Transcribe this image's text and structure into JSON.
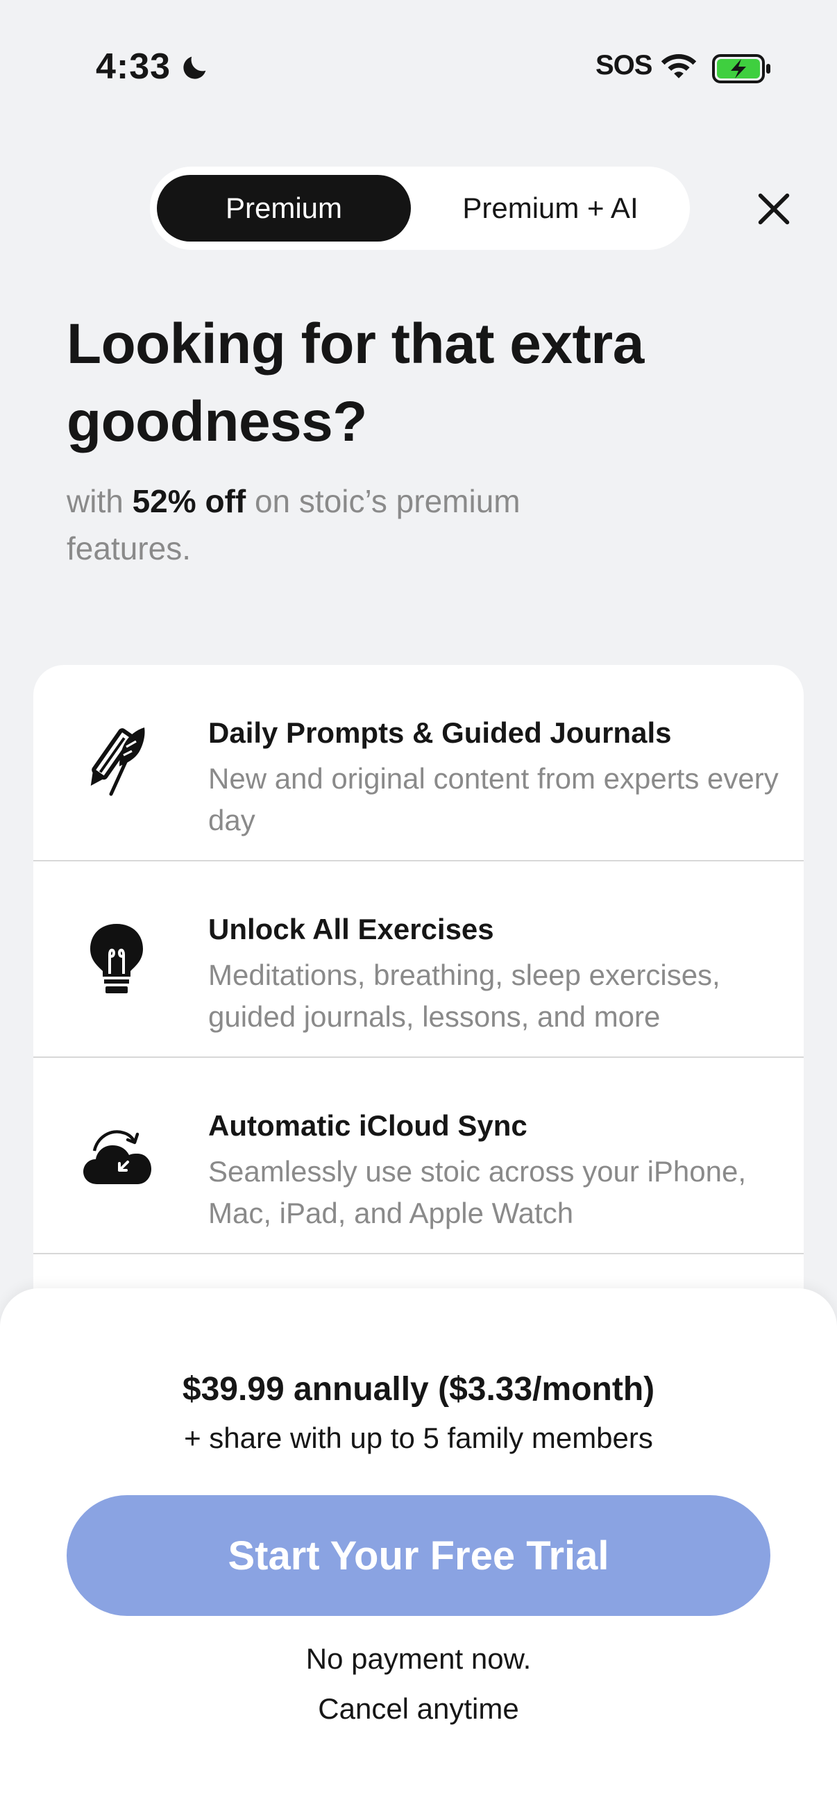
{
  "status_bar": {
    "time": "4:33",
    "sos": "SOS",
    "battery_color": "#3fcf3f"
  },
  "tabs": {
    "active_label": "Premium",
    "inactive_label": "Premium + AI"
  },
  "headline": {
    "title": "Looking for that extra goodness?",
    "sub_prefix": "with ",
    "sub_highlight": "52% off",
    "sub_suffix": " on stoic’s premium features."
  },
  "features": [
    {
      "icon": "pencil-feather-icon",
      "title": "Daily Prompts & Guided Journals",
      "description": "New and original content from experts every day"
    },
    {
      "icon": "lightbulb-icon",
      "title": "Unlock All Exercises",
      "description": "Meditations, breathing, sleep exercises, guided journals, lessons, and more"
    },
    {
      "icon": "cloud-sync-icon",
      "title": "Automatic iCloud Sync",
      "description": "Seamlessly use stoic across your iPhone, Mac, iPad, and Apple Watch"
    }
  ],
  "purchase": {
    "price": "$39.99 annually ($3.33/month)",
    "family": "+ share with up to 5 family members",
    "cta_label": "Start Your Free Trial",
    "cta_color": "#8aa3e2",
    "note_line1": "No payment now.",
    "note_line2": "Cancel anytime"
  }
}
